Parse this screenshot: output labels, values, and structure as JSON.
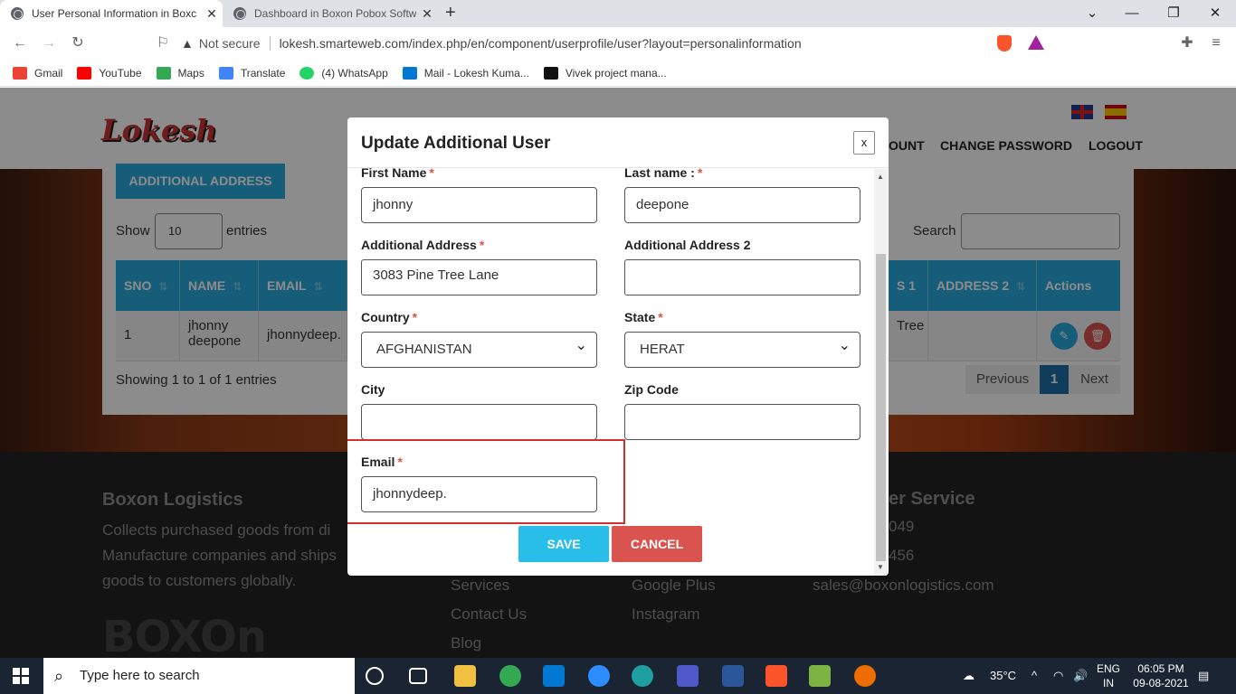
{
  "browser": {
    "tabs": [
      {
        "title": "User Personal Information in Boxc",
        "active": true
      },
      {
        "title": "Dashboard in Boxon Pobox Software",
        "active": false
      }
    ],
    "security_label": "Not secure",
    "url": "lokesh.smarteweb.com/index.php/en/component/userprofile/user?layout=personalinformation",
    "bookmarks": [
      {
        "label": "Gmail",
        "icon": "gmail-icon",
        "color": "#ea4335"
      },
      {
        "label": "YouTube",
        "icon": "youtube-icon",
        "color": "#ff0000"
      },
      {
        "label": "Maps",
        "icon": "maps-icon",
        "color": "#34a853"
      },
      {
        "label": "Translate",
        "icon": "translate-icon",
        "color": "#4285f4"
      },
      {
        "label": "(4) WhatsApp",
        "icon": "whatsapp-icon",
        "color": "#25d366"
      },
      {
        "label": "Mail - Lokesh Kuma...",
        "icon": "outlook-icon",
        "color": "#0078d4"
      },
      {
        "label": "Vivek project mana...",
        "icon": "vivek-icon",
        "color": "#111111"
      }
    ]
  },
  "site": {
    "logo": "Lokesh",
    "nav": [
      "OUNT",
      "CHANGE PASSWORD",
      "LOGOUT"
    ],
    "additional_address_button": "ADDITIONAL ADDRESS",
    "show_label": "Show",
    "show_value": "10",
    "entries_label": "entries",
    "search_label": "Search",
    "table": {
      "headers": [
        "SNO",
        "NAME",
        "EMAIL",
        "S 1",
        "ADDRESS 2",
        "Actions"
      ],
      "row": {
        "sno": "1",
        "name": "jhonny deepone",
        "email": "jhonnydeep.",
        "address1_fragment": "Tree"
      }
    },
    "showing_text": "Showing 1 to 1 of 1 entries",
    "pager": {
      "previous": "Previous",
      "current": "1",
      "next": "Next"
    },
    "footer": {
      "company_title": "Boxon Logistics",
      "company_text_1": "Collects purchased goods from di",
      "company_text_2": "Manufacture companies and ships",
      "company_text_3": "goods to customers globally.",
      "links": [
        "Services",
        "Contact Us",
        "Blog"
      ],
      "social": [
        "Google Plus",
        "Instagram"
      ],
      "service_title": "er Service",
      "phone_1": "049",
      "phone_2": "456",
      "email": "sales@boxonlogistics.com",
      "brand": "BOXOn"
    }
  },
  "modal": {
    "title": "Update Additional User",
    "close": "x",
    "first_name_label": "First Name",
    "first_name_value": "jhonny",
    "last_name_label": "Last name :",
    "last_name_value": "deepone",
    "address_label": "Additional Address",
    "address_value": "3083 Pine Tree Lane",
    "address2_label": "Additional Address 2",
    "address2_value": "",
    "country_label": "Country",
    "country_value": "AFGHANISTAN",
    "state_label": "State",
    "state_value": "HERAT",
    "city_label": "City",
    "city_value": "",
    "zip_label": "Zip Code",
    "zip_value": "",
    "email_label": "Email",
    "email_value": "jhonnydeep.",
    "required_mark": "*",
    "save": "SAVE",
    "cancel": "CANCEL"
  },
  "taskbar": {
    "search_placeholder": "Type here to search",
    "weather": "35°C",
    "lang_1": "ENG",
    "lang_2": "IN",
    "time": "06:05 PM",
    "date": "09-08-2021"
  },
  "colors": {
    "primary": "#29a9df",
    "danger": "#d9534f",
    "highlight": "#d32f2f"
  }
}
